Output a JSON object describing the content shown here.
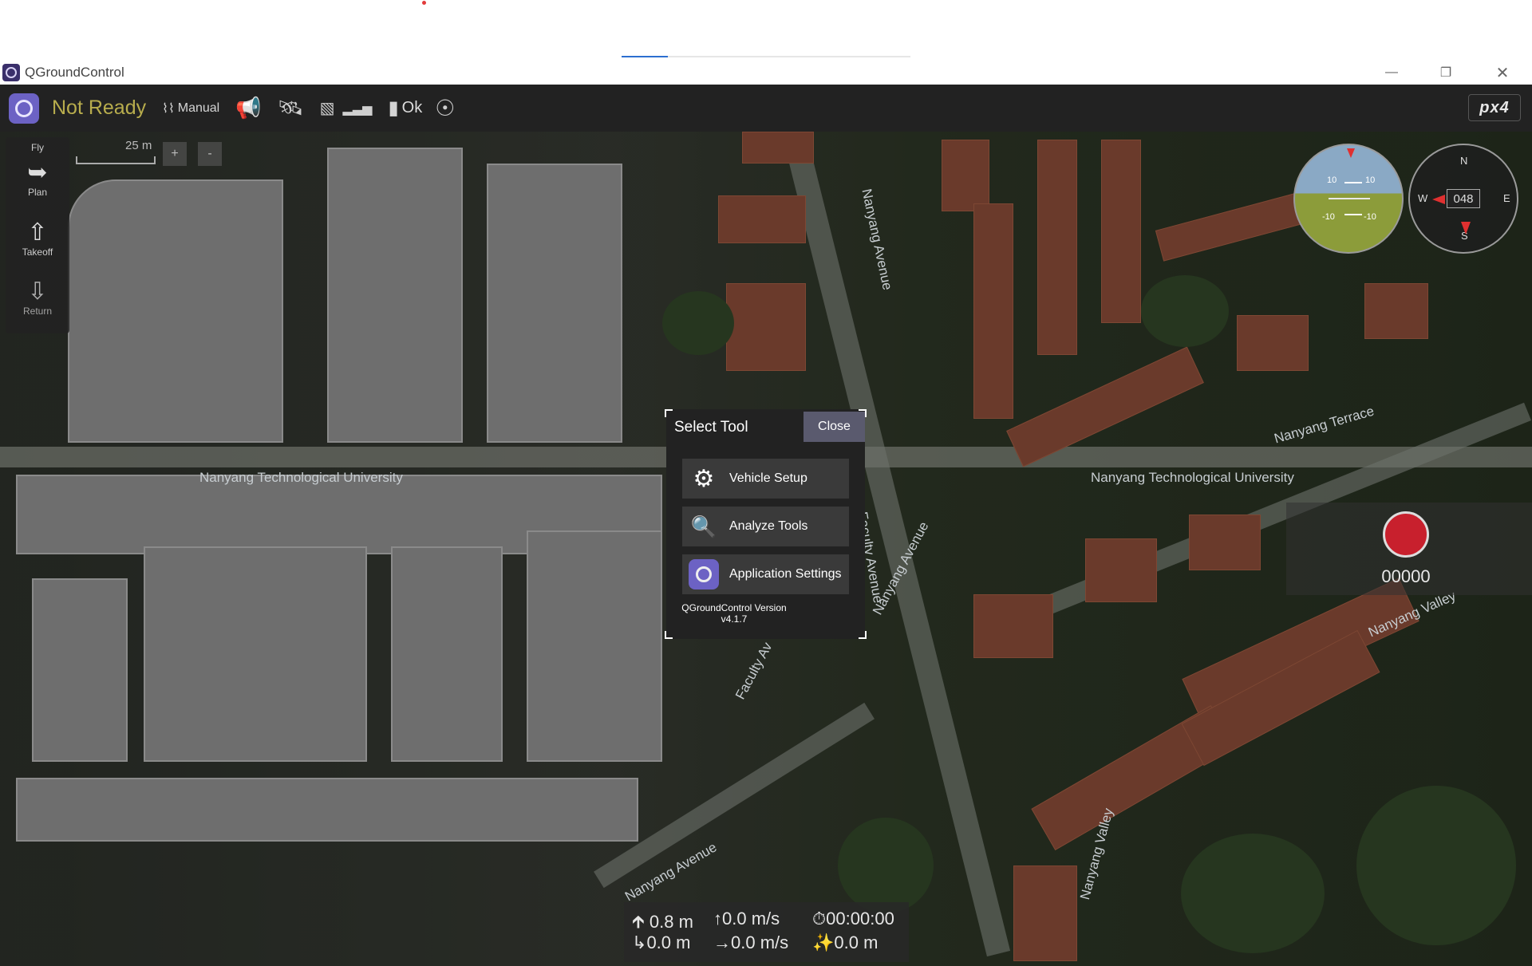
{
  "window": {
    "title": "QGroundControl"
  },
  "loading_bar": {
    "progress": 0.16
  },
  "toolbar": {
    "status": "Not Ready",
    "flight_mode": "Manual",
    "battery": "Ok",
    "brand": "PX4 autopilot"
  },
  "left_toolbar": {
    "header": "Fly",
    "items": [
      {
        "label": "Plan",
        "icon": "plan-icon"
      },
      {
        "label": "Takeoff",
        "icon": "takeoff-icon"
      },
      {
        "label": "Return",
        "icon": "return-icon"
      }
    ]
  },
  "map": {
    "scale_label": "25 m",
    "zoom_in": "+",
    "zoom_out": "-",
    "labels": [
      "Nanyang Avenue",
      "Nanyang Technological University",
      "Nanyang Technological University",
      "Nanyang Terrace",
      "Faculty Avenue",
      "Nanyang Avenue",
      "Faculty Av",
      "Nanyang Valley",
      "Nanyang Avenue",
      "Nanyang Valley"
    ]
  },
  "instruments": {
    "pitch_ticks": [
      "10",
      "10",
      "-10",
      "-10"
    ],
    "compass_points": [
      "N",
      "E",
      "S",
      "W"
    ],
    "heading": "048"
  },
  "video": {
    "recording_counter": "00000"
  },
  "dialog": {
    "title": "Select Tool",
    "close": "Close",
    "items": [
      {
        "label": "Vehicle Setup",
        "icon": "gears-icon"
      },
      {
        "label": "Analyze Tools",
        "icon": "analyze-icon"
      },
      {
        "label": "Application Settings",
        "icon": "qgc-logo-icon"
      }
    ],
    "version_line1": "QGroundControl Version",
    "version_line2": "v4.1.7"
  },
  "telemetry": {
    "altitude": "0.8 m",
    "vertical_speed": "0.0 m/s",
    "flight_time": "00:00:00",
    "distance_home": "0.0 m",
    "horizontal_speed": "0.0 m/s",
    "odometer": "0.0 m"
  }
}
